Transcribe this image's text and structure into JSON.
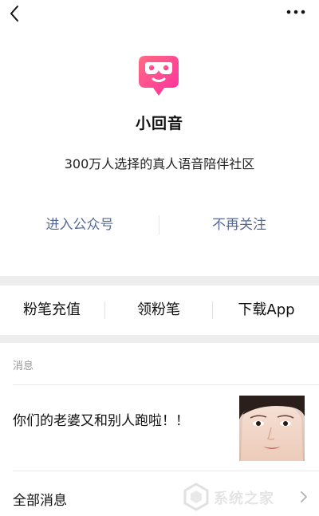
{
  "topbar": {
    "back_icon": "chevron-left-icon",
    "more_icon": "more-horizontal-icon"
  },
  "profile": {
    "logo_icon": "xiaohuiyin-logo",
    "name": "小回音",
    "description": "300万人选择的真人语音陪伴社区",
    "enter_label": "进入公众号",
    "unfollow_label": "不再关注"
  },
  "menu": {
    "items": [
      {
        "label": "粉笔充值"
      },
      {
        "label": "领粉笔"
      },
      {
        "label": "下载App"
      }
    ]
  },
  "messages": {
    "section_label": "消息",
    "items": [
      {
        "title": "你们的老婆又和别人跑啦！！",
        "thumbnail": "woman-portrait-image"
      }
    ],
    "all_label": "全部消息"
  },
  "watermark": {
    "text": "系统之家"
  },
  "colors": {
    "link": "#576b95",
    "logo_gradient_start": "#ff5f8a",
    "logo_gradient_end": "#ff3a9c",
    "separator": "#ededed"
  }
}
